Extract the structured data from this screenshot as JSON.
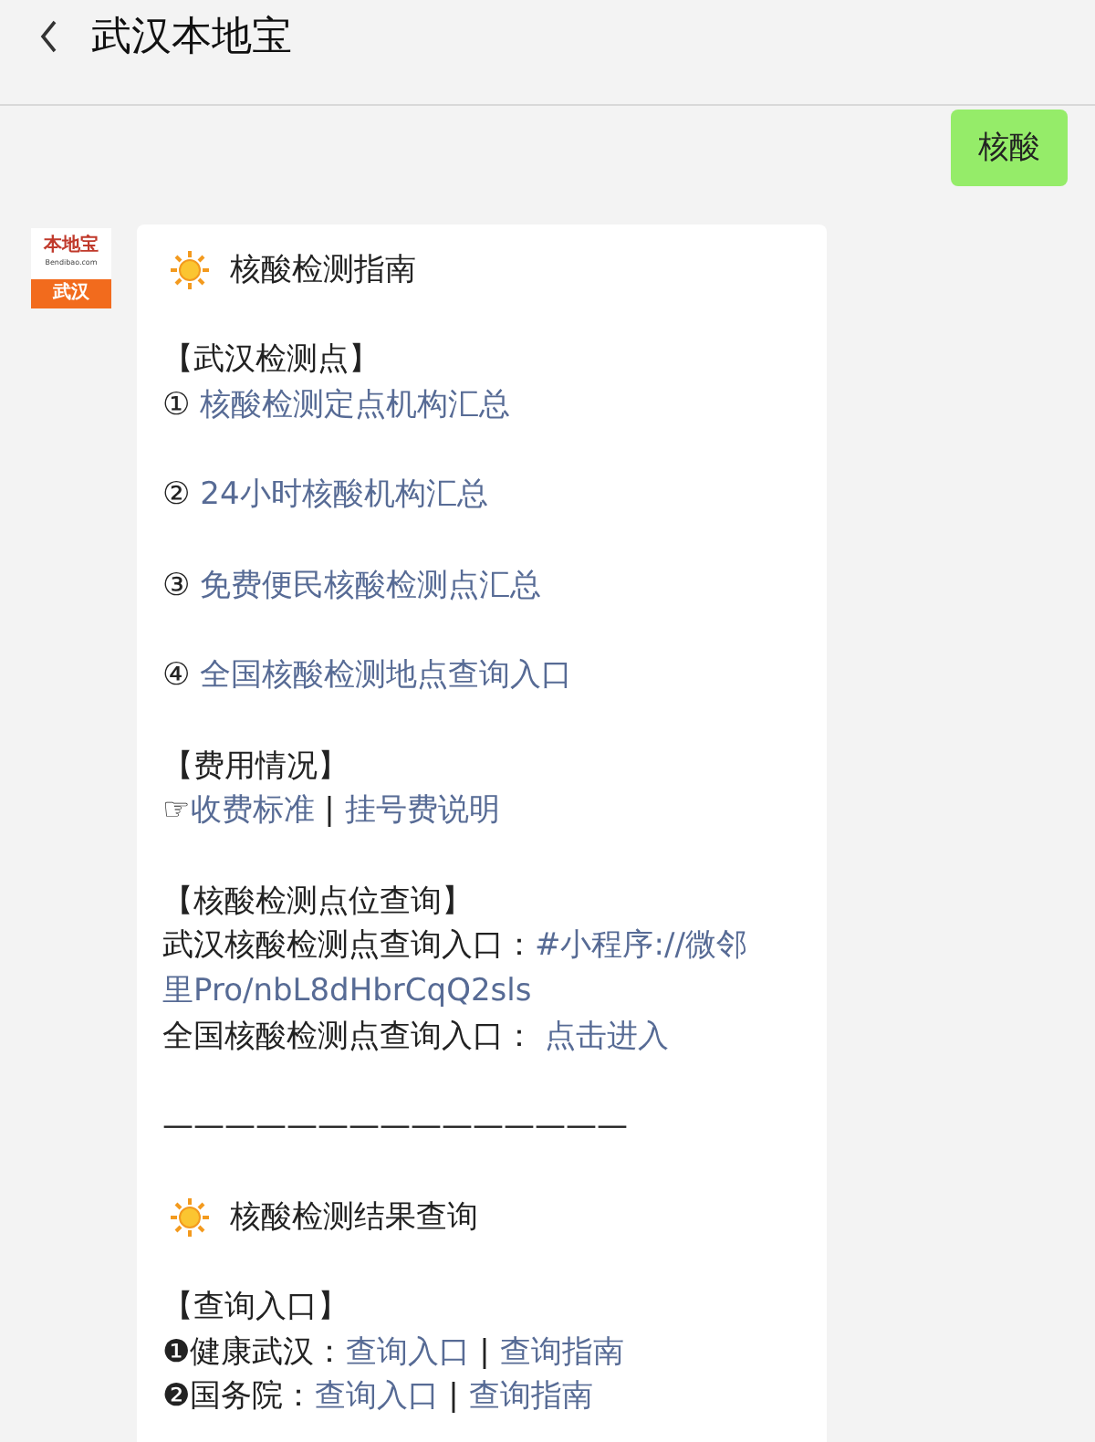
{
  "header": {
    "title": "武汉本地宝"
  },
  "sent_message": {
    "text": "核酸"
  },
  "avatar": {
    "brand": "本地宝",
    "domain": "Bendibao.com",
    "city": "武汉"
  },
  "reply": {
    "lines": [
      {
        "kind": "heading",
        "text": "核酸检测指南"
      },
      {
        "kind": "blank"
      },
      {
        "kind": "line",
        "parts": [
          {
            "kind": "text",
            "text": "【武汉检测点】"
          }
        ]
      },
      {
        "kind": "line",
        "parts": [
          {
            "kind": "text",
            "text": "① "
          },
          {
            "kind": "link",
            "text": "核酸检测定点机构汇总"
          }
        ]
      },
      {
        "kind": "blank"
      },
      {
        "kind": "line",
        "parts": [
          {
            "kind": "text",
            "text": "② "
          },
          {
            "kind": "link",
            "text": "24小时核酸机构汇总"
          }
        ]
      },
      {
        "kind": "blank"
      },
      {
        "kind": "line",
        "parts": [
          {
            "kind": "text",
            "text": "③ "
          },
          {
            "kind": "link",
            "text": "免费便民核酸检测点汇总"
          }
        ]
      },
      {
        "kind": "blank"
      },
      {
        "kind": "line",
        "parts": [
          {
            "kind": "text",
            "text": "④ "
          },
          {
            "kind": "link",
            "text": "全国核酸检测地点查询入口"
          }
        ]
      },
      {
        "kind": "blank"
      },
      {
        "kind": "line",
        "parts": [
          {
            "kind": "text",
            "text": "【费用情况】"
          }
        ]
      },
      {
        "kind": "line",
        "parts": [
          {
            "kind": "text",
            "text": "☞"
          },
          {
            "kind": "link",
            "text": "收费标准"
          },
          {
            "kind": "text",
            "text": " | "
          },
          {
            "kind": "link",
            "text": "挂号费说明"
          }
        ]
      },
      {
        "kind": "blank"
      },
      {
        "kind": "line",
        "parts": [
          {
            "kind": "text",
            "text": "【核酸检测点位查询】"
          }
        ]
      },
      {
        "kind": "line",
        "parts": [
          {
            "kind": "text",
            "text": "武汉核酸检测点查询入口："
          },
          {
            "kind": "link",
            "text": "#小程序://微邻"
          }
        ]
      },
      {
        "kind": "line",
        "parts": [
          {
            "kind": "link",
            "text": "里Pro/nbL8dHbrCqQ2sls"
          }
        ]
      },
      {
        "kind": "line",
        "parts": [
          {
            "kind": "text",
            "text": "全国核酸检测点查询入口： "
          },
          {
            "kind": "link",
            "text": "点击进入"
          }
        ]
      },
      {
        "kind": "blank"
      },
      {
        "kind": "line",
        "parts": [
          {
            "kind": "text",
            "text": "———————————————"
          }
        ]
      },
      {
        "kind": "blank"
      },
      {
        "kind": "heading",
        "text": "核酸检测结果查询"
      },
      {
        "kind": "blank"
      },
      {
        "kind": "line",
        "parts": [
          {
            "kind": "text",
            "text": "【查询入口】"
          }
        ]
      },
      {
        "kind": "line",
        "parts": [
          {
            "kind": "text",
            "text": "❶健康武汉："
          },
          {
            "kind": "link",
            "text": "查询入口"
          },
          {
            "kind": "text",
            "text": " | "
          },
          {
            "kind": "link",
            "text": "查询指南"
          }
        ]
      },
      {
        "kind": "line",
        "parts": [
          {
            "kind": "text",
            "text": "❷国务院："
          },
          {
            "kind": "link",
            "text": "查询入口"
          },
          {
            "kind": "text",
            "text": " | "
          },
          {
            "kind": "link",
            "text": "查询指南"
          }
        ]
      }
    ]
  }
}
